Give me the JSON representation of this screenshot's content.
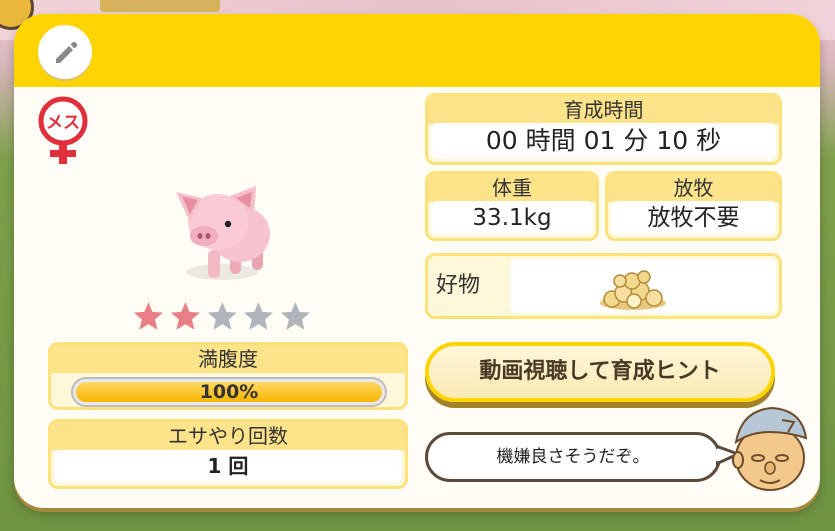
{
  "panel": {
    "edit_icon": "pencil-icon",
    "gender": {
      "label": "メス",
      "icon": "female-symbol-icon",
      "color": "#e0303c"
    },
    "rating": {
      "value": 2,
      "max": 5,
      "filled_color": "#e87f86",
      "empty_color": "#b0b4bb"
    },
    "satiety": {
      "label": "満腹度",
      "percent": 100,
      "display": "100%"
    },
    "feed_count": {
      "label": "エサやり回数",
      "value": "1 回"
    },
    "growth_time": {
      "label": "育成時間",
      "value": "00 時間 01 分 10 秒"
    },
    "weight": {
      "label": "体重",
      "value": "33.1kg"
    },
    "grazing": {
      "label": "放牧",
      "value": "放牧不要"
    },
    "favorite": {
      "label": "好物",
      "icon": "grain-pile-icon"
    },
    "hint_button": {
      "label": "動画視聴して育成ヒント"
    },
    "advisor": {
      "message": "機嫌良さそうだぞ。",
      "icon": "farmer-face-icon"
    }
  },
  "colors": {
    "header": "#ffd400",
    "box_fill": "#fff8d8",
    "box_border": "#fbe27a"
  }
}
